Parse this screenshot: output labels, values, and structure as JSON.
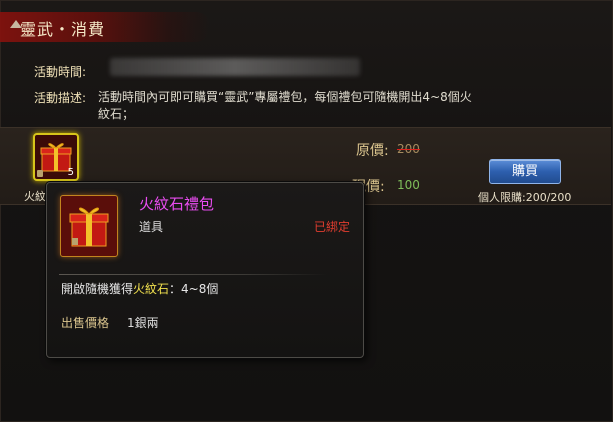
{
  "header": {
    "title": "靈武・消費"
  },
  "activity": {
    "time_label": "活動時間:",
    "desc_label": "活動描述:",
    "description": "活動時間內可即可購買“靈武”專屬禮包，每個禮包可隨機開出4~8個火紋石；"
  },
  "item": {
    "short_name": "火紋",
    "quantity": "5",
    "original_price_label": "原價:",
    "original_price": "200",
    "current_price_label": "現價:",
    "current_price": "100",
    "buy_label": "購買",
    "limit_text": "個人限購:200/200"
  },
  "tooltip": {
    "name": "火紋石禮包",
    "type": "道具",
    "bound": "已綁定",
    "effect_prefix": "開啟隨機獲得",
    "effect_highlight": "火紋石",
    "effect_suffix": "：4~8個",
    "sell_label": "出售價格",
    "sell_value": "1銀兩"
  },
  "colors": {
    "title_bg": "#82120e",
    "gold_text": "#dbc58e",
    "tooltip_name": "#e84cf0",
    "bound_red": "#e13d2f",
    "highlight_yellow": "#f2e24f",
    "current_price_green": "#7fbe5a",
    "buy_button_blue": "#2d5fae"
  }
}
